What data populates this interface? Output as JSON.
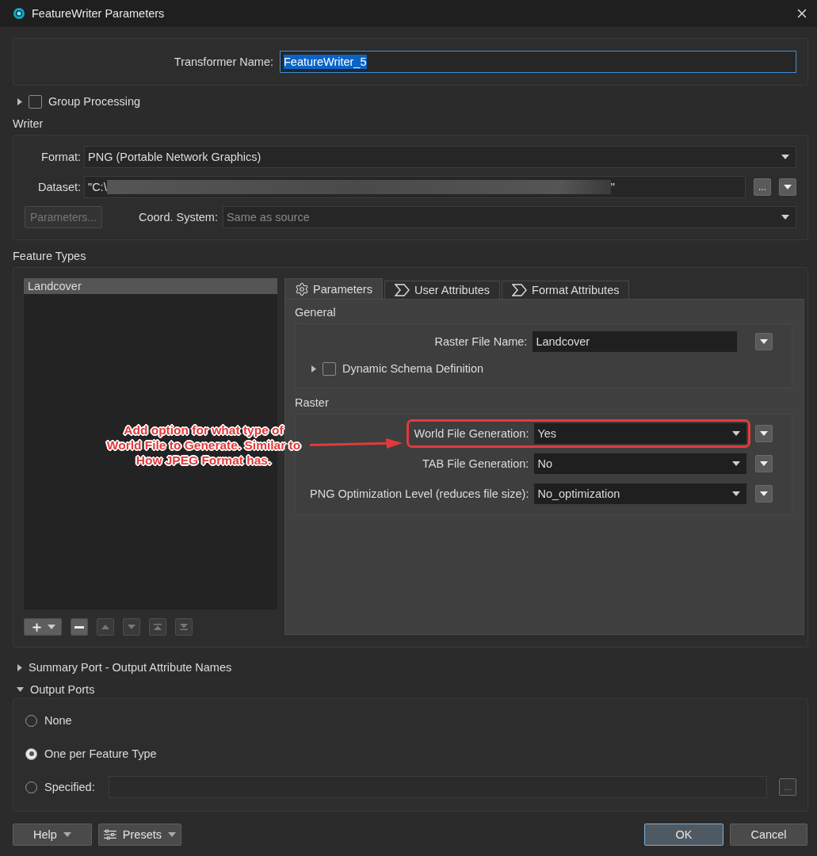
{
  "window": {
    "title": "FeatureWriter Parameters"
  },
  "transformer_name": {
    "label": "Transformer Name:",
    "value": "FeatureWriter_5"
  },
  "group_processing": {
    "label": "Group Processing",
    "checked": false,
    "expanded": false
  },
  "writer": {
    "title": "Writer",
    "format": {
      "label": "Format:",
      "value": "PNG (Portable Network Graphics)"
    },
    "dataset": {
      "label": "Dataset:",
      "prefix": "\"C:\\",
      "suffix": "\"",
      "browse": "..."
    },
    "parameters_button": {
      "label": "Parameters...",
      "disabled": true
    },
    "coord_system": {
      "label": "Coord. System:",
      "placeholder": "Same as source"
    }
  },
  "feature_types": {
    "title": "Feature Types",
    "items": [
      {
        "label": "Landcover",
        "selected": true
      }
    ],
    "tabs": [
      {
        "label": "Parameters",
        "kind": "settings",
        "selected": true
      },
      {
        "label": "User Attributes",
        "kind": "attributes",
        "selected": false
      },
      {
        "label": "Format Attributes",
        "kind": "attributes",
        "selected": false
      }
    ],
    "general": {
      "title": "General",
      "raster_file_name": {
        "label": "Raster File Name:",
        "value": "Landcover"
      },
      "dynamic_schema": {
        "label": "Dynamic Schema Definition",
        "checked": false,
        "expanded": false
      }
    },
    "raster": {
      "title": "Raster",
      "rows": [
        {
          "label": "World File Generation:",
          "value": "Yes",
          "highlighted": true
        },
        {
          "label": "TAB File Generation:",
          "value": "No",
          "highlighted": false
        },
        {
          "label": "PNG Optimization Level (reduces file size):",
          "value": "No_optimization",
          "highlighted": false
        }
      ]
    }
  },
  "annotation": {
    "lines": [
      "Add option for what type of",
      "World File to Generate. Similar to",
      "How JPEG Format has."
    ]
  },
  "summary_port": {
    "label": "Summary Port - Output Attribute Names",
    "expanded": false
  },
  "output_ports": {
    "label": "Output Ports",
    "expanded": true,
    "options": [
      {
        "label": "None",
        "kind": "plain",
        "selected": false
      },
      {
        "label": "One per Feature Type",
        "kind": "plain",
        "selected": true
      },
      {
        "label": "Specified:",
        "kind": "field",
        "selected": false,
        "browse": "..."
      }
    ]
  },
  "footer": {
    "help": "Help",
    "presets": "Presets",
    "ok": "OK",
    "cancel": "Cancel"
  }
}
